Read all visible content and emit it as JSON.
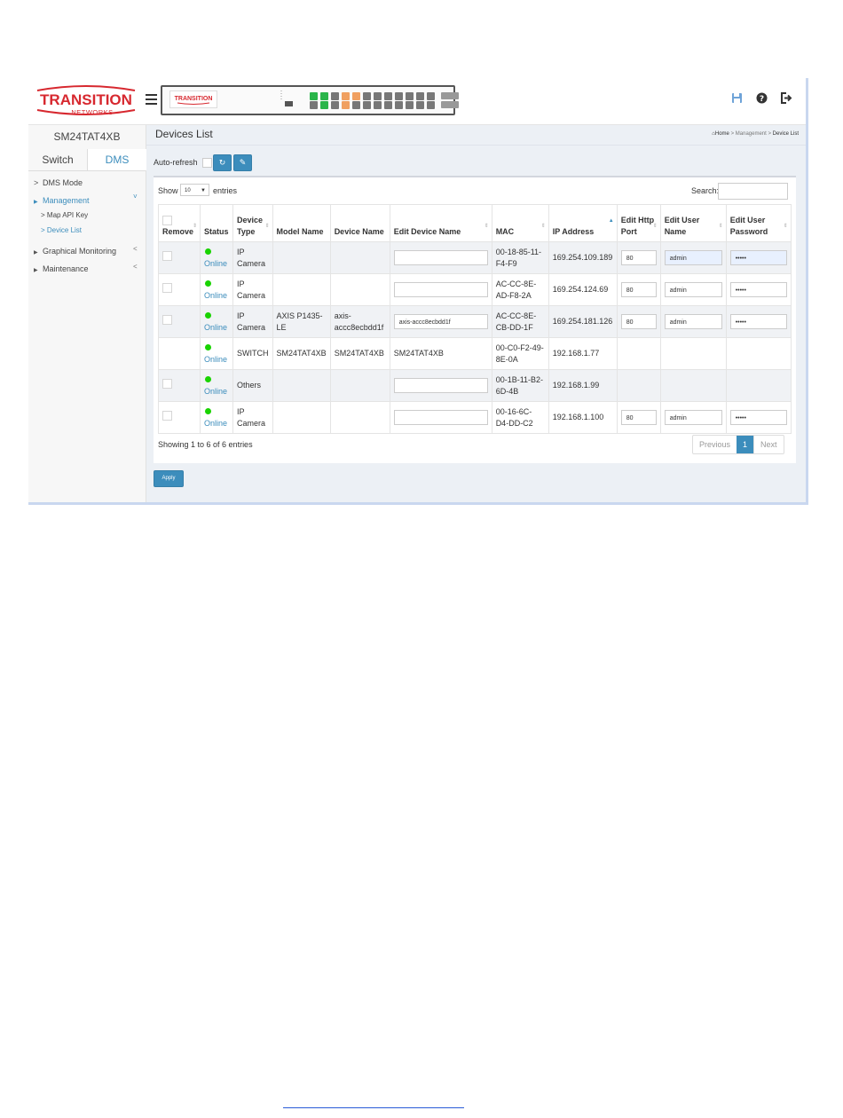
{
  "header": {
    "logo_main": "TRANSITION",
    "logo_sub": "NETWORKS",
    "panel_logo": "TRANSITION",
    "icons": [
      "save-icon",
      "help-icon",
      "logout-icon"
    ],
    "save_glyph": "💾",
    "help_glyph": "?",
    "logout_glyph": "⇥",
    "brand_color": "#d7282f",
    "accent_color": "#3c8dbc"
  },
  "sidebar": {
    "device_name": "SM24TAT4XB",
    "tabs": [
      "Switch",
      "DMS"
    ],
    "active_tab": "DMS",
    "items": [
      {
        "label": "DMS Mode",
        "caret": ">"
      },
      {
        "label": "Management",
        "caret": "▶"
      },
      {
        "label": "Map API Key",
        "caret": ">"
      },
      {
        "label": "Device List",
        "caret": ">"
      },
      {
        "label": "Graphical Monitoring",
        "caret": "▶"
      },
      {
        "label": "Maintenance",
        "caret": "▶"
      }
    ],
    "chevrons": {
      "management": "˅",
      "graphical": "<",
      "maintenance": "<"
    }
  },
  "main": {
    "title": "Devices List",
    "breadcrumb": {
      "home": "Home",
      "sep": ">",
      "management": "Management",
      "current": "Device List"
    },
    "auto_refresh_label": "Auto-refresh",
    "refresh_glyph": "↻",
    "edit_glyph": "✎",
    "apply_label": "Apply"
  },
  "table": {
    "show_label": "Show",
    "page_size": "10",
    "entries_label": "entries",
    "search_label": "Search:",
    "search_value": "",
    "columns": [
      "Remove",
      "Status",
      "Device Type",
      "Model Name",
      "Device Name",
      "Edit Device Name",
      "MAC",
      "IP Address",
      "Edit Http Port",
      "Edit User Name",
      "Edit User Password"
    ],
    "rows": [
      {
        "status": "Online",
        "type": "IP Camera",
        "model": "",
        "device": "",
        "edit_name": "",
        "mac": "00-18-85-11-F4-F9",
        "ip": "169.254.109.189",
        "port": "80",
        "user": "admin",
        "password": "•••••"
      },
      {
        "status": "Online",
        "type": "IP Camera",
        "model": "",
        "device": "",
        "edit_name": "",
        "mac": "AC-CC-8E-AD-F8-2A",
        "ip": "169.254.124.69",
        "port": "80",
        "user": "admin",
        "password": "•••••"
      },
      {
        "status": "Online",
        "type": "IP Camera",
        "model": "AXIS P1435-LE",
        "device": "axis-accc8ecbdd1f",
        "edit_name": "axis-accc8ecbdd1f",
        "mac": "AC-CC-8E-CB-DD-1F",
        "ip": "169.254.181.126",
        "port": "80",
        "user": "admin",
        "password": "•••••"
      },
      {
        "status": "Online",
        "type": "SWITCH",
        "model": "SM24TAT4XB",
        "device": "SM24TAT4XB",
        "edit_name": "SM24TAT4XB",
        "mac": "00-C0-F2-49-8E-0A",
        "ip": "192.168.1.77",
        "port": "",
        "user": "",
        "password": ""
      },
      {
        "status": "Online",
        "type": "Others",
        "model": "",
        "device": "",
        "edit_name": "",
        "mac": "00-1B-11-B2-6D-4B",
        "ip": "192.168.1.99",
        "port": "",
        "user": "",
        "password": ""
      },
      {
        "status": "Online",
        "type": "IP Camera",
        "model": "",
        "device": "",
        "edit_name": "",
        "mac": "00-16-6C-D4-DD-C2",
        "ip": "192.168.1.100",
        "port": "80",
        "user": "admin",
        "password": "•••••"
      }
    ],
    "info": "Showing 1 to 6 of 6 entries",
    "pager": {
      "previous": "Previous",
      "current": "1",
      "next": "Next"
    }
  }
}
